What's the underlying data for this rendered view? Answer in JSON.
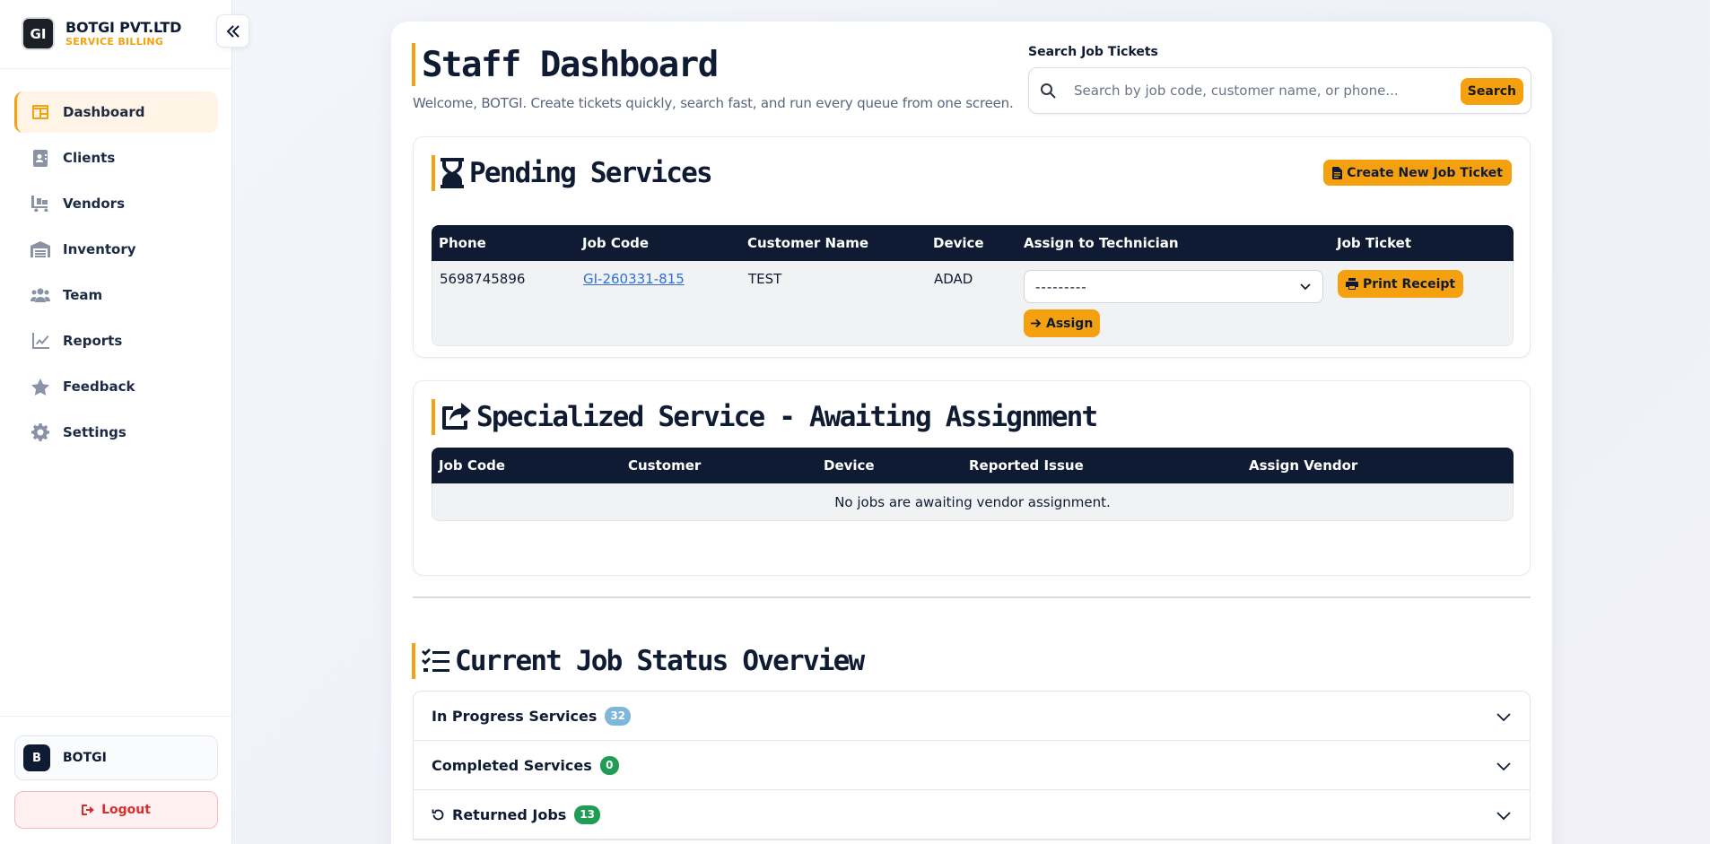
{
  "brand": {
    "logo": "GI",
    "name": "BOTGI PVT.LTD",
    "subtitle": "SERVICE BILLING"
  },
  "sidebar": {
    "items": [
      {
        "label": "Dashboard",
        "icon": "dashboard-icon",
        "active": true
      },
      {
        "label": "Clients",
        "icon": "clients-icon"
      },
      {
        "label": "Vendors",
        "icon": "vendors-icon"
      },
      {
        "label": "Inventory",
        "icon": "inventory-icon"
      },
      {
        "label": "Team",
        "icon": "team-icon"
      },
      {
        "label": "Reports",
        "icon": "reports-icon"
      },
      {
        "label": "Feedback",
        "icon": "star-icon"
      },
      {
        "label": "Settings",
        "icon": "gear-icon"
      }
    ],
    "user": {
      "initial": "B",
      "name": "BOTGI"
    },
    "logout_label": "Logout"
  },
  "header": {
    "title": "Staff Dashboard",
    "welcome": "Welcome, BOTGI. Create tickets quickly, search fast, and run every queue from one screen."
  },
  "search": {
    "label": "Search Job Tickets",
    "placeholder": "Search by job code, customer name, or phone...",
    "button": "Search"
  },
  "pending": {
    "title": "Pending Services",
    "create_button": "Create New Job Ticket",
    "columns": [
      "Phone",
      "Job Code",
      "Customer Name",
      "Device",
      "Assign to Technician",
      "Job Ticket"
    ],
    "rows": [
      {
        "phone": "5698745896",
        "job_code": "GI-260331-815",
        "customer": "TEST",
        "device": "ADAD",
        "technician": "---------",
        "assign_button": "Assign",
        "print_button": "Print Receipt"
      }
    ]
  },
  "specialized": {
    "title": "Specialized Service - Awaiting Assignment",
    "columns": [
      "Job Code",
      "Customer",
      "Device",
      "Reported Issue",
      "Assign Vendor"
    ],
    "empty_message": "No jobs are awaiting vendor assignment."
  },
  "overview": {
    "title": "Current Job Status Overview",
    "groups": [
      {
        "label": "In Progress Services",
        "count": "32",
        "color": "#7fb6dc"
      },
      {
        "label": "Completed Services",
        "count": "0",
        "color": "#1f9d55"
      },
      {
        "label": "Returned Jobs",
        "count": "13",
        "color": "#1f9d55"
      }
    ]
  },
  "colors": {
    "accent": "#f5a00f",
    "navy": "#0f1b33",
    "link": "#2f6fd6",
    "danger": "#d92d2d"
  }
}
